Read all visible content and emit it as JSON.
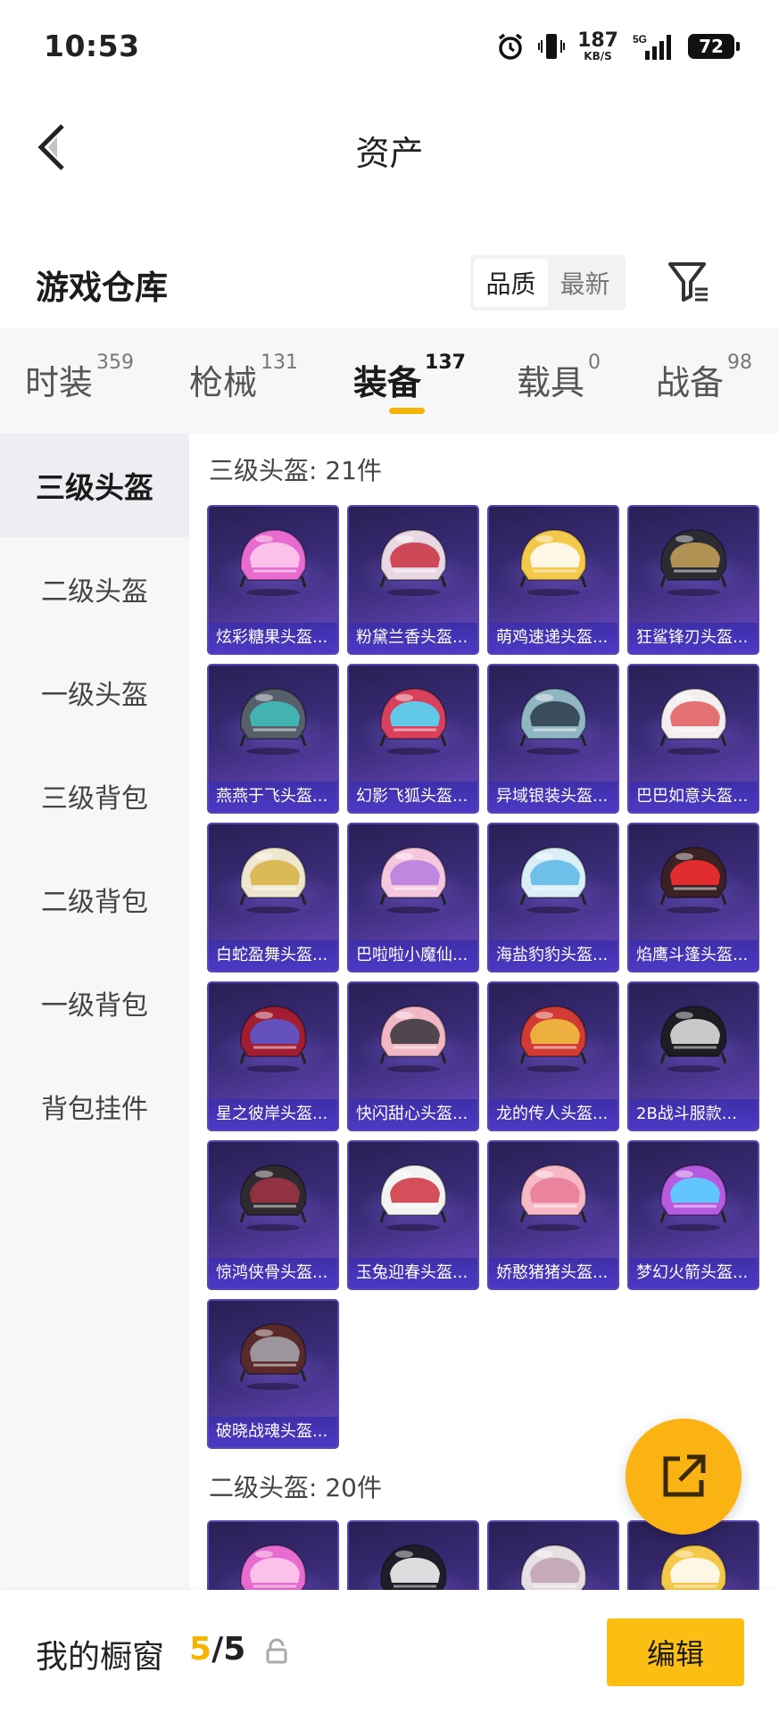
{
  "status_bar": {
    "time": "10:53",
    "net_speed": "187",
    "net_unit": "KB/S",
    "network": "5G",
    "battery": "72"
  },
  "header": {
    "title": "资产"
  },
  "warehouse": {
    "title": "游戏仓库",
    "sort_options": [
      "品质",
      "最新"
    ],
    "active_sort": "品质"
  },
  "category_tabs": [
    {
      "label": "时装",
      "count": "359"
    },
    {
      "label": "枪械",
      "count": "131"
    },
    {
      "label": "装备",
      "count": "137",
      "active": true
    },
    {
      "label": "载具",
      "count": "0"
    },
    {
      "label": "战备",
      "count": "98"
    }
  ],
  "side_nav": [
    "三级头盔",
    "二级头盔",
    "一级头盔",
    "三级背包",
    "二级背包",
    "一级背包",
    "背包挂件"
  ],
  "sections": [
    {
      "title": "三级头盔: 21件",
      "items": [
        {
          "name": "炫彩糖果头盔...",
          "color": "#e86bd0",
          "accent": "#ffd0f0"
        },
        {
          "name": "粉黛兰香头盔...",
          "color": "#e9d8e4",
          "accent": "#c9303f"
        },
        {
          "name": "萌鸡速递头盔...",
          "color": "#f4c84a",
          "accent": "#ffffff"
        },
        {
          "name": "狂鲨锋刃头盔...",
          "color": "#2b2b33",
          "accent": "#c9a35b"
        },
        {
          "name": "燕燕于飞头盔...",
          "color": "#55606a",
          "accent": "#3fc1c0"
        },
        {
          "name": "幻影飞狐头盔...",
          "color": "#d8405c",
          "accent": "#4de0ff"
        },
        {
          "name": "异域银装头盔...",
          "color": "#8fb6c2",
          "accent": "#2b3b48"
        },
        {
          "name": "巴巴如意头盔...",
          "color": "#f3eef0",
          "accent": "#e05a5a"
        },
        {
          "name": "白蛇盈舞头盔...",
          "color": "#efe6cf",
          "accent": "#d6b042"
        },
        {
          "name": "巴啦啦小魔仙...",
          "color": "#f6c6de",
          "accent": "#b77be0"
        },
        {
          "name": "海盐豹豹头盔...",
          "color": "#d9eef6",
          "accent": "#5ab6e6"
        },
        {
          "name": "焰鹰斗篷头盔...",
          "color": "#3b2024",
          "accent": "#ff3030"
        },
        {
          "name": "星之彼岸头盔...",
          "color": "#a21d32",
          "accent": "#5b5bd6"
        },
        {
          "name": "快闪甜心头盔...",
          "color": "#f1b7c5",
          "accent": "#333338"
        },
        {
          "name": "龙的传人头盔...",
          "color": "#d23b34",
          "accent": "#f2c440"
        },
        {
          "name": "2B战斗服款...",
          "color": "#1d1d22",
          "accent": "#e8e8e8"
        },
        {
          "name": "惊鸿侠骨头盔...",
          "color": "#2e2a2e",
          "accent": "#a33444"
        },
        {
          "name": "玉兔迎春头盔...",
          "color": "#f2f2f2",
          "accent": "#d03240"
        },
        {
          "name": "娇憨猪猪头盔...",
          "color": "#f7b8c6",
          "accent": "#e87a96"
        },
        {
          "name": "梦幻火箭头盔...",
          "color": "#b65be0",
          "accent": "#54d8ff"
        },
        {
          "name": "破晓战魂头盔...",
          "color": "#5a2a2a",
          "accent": "#a8a8b0"
        }
      ]
    },
    {
      "title": "二级头盔: 20件",
      "items": [
        {
          "name": "",
          "color": "#e86bd0",
          "accent": "#ffd0f0"
        },
        {
          "name": "",
          "color": "#1e1e28",
          "accent": "#ffffff"
        },
        {
          "name": "",
          "color": "#e6e0e4",
          "accent": "#c0a0b0"
        },
        {
          "name": "",
          "color": "#f4c84a",
          "accent": "#ffffff"
        }
      ]
    }
  ],
  "bottom": {
    "showcase_label": "我的橱窗",
    "showcase_current": "5",
    "showcase_total": "/5",
    "edit_label": "编辑"
  }
}
